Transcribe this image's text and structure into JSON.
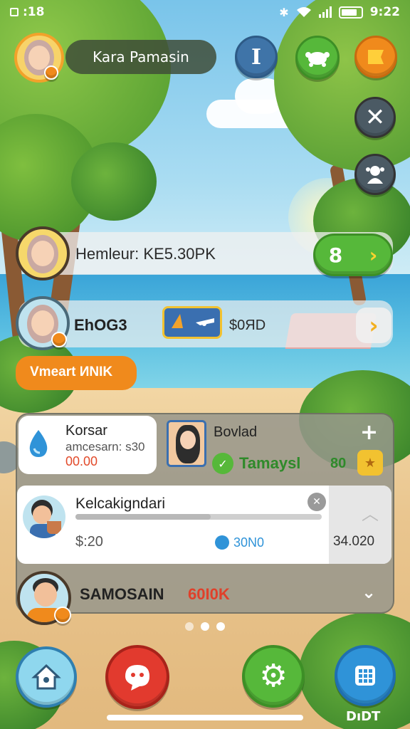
{
  "status_bar": {
    "time": ":18",
    "clock_right": "9:22"
  },
  "header": {
    "player_name": "Kara Pamasin"
  },
  "rows": [
    {
      "label": "Hemleur: KE5.30PK",
      "count": "8"
    },
    {
      "label": "EhOG3",
      "value": "$0ЯD",
      "sub_label": "Vmeart ИNIK"
    }
  ],
  "panel": {
    "card1": {
      "title": "Korsar",
      "subtitle": "amcesarn: s30",
      "value": "00.00"
    },
    "card2": {
      "title": "Bovlad",
      "status": "Tamaysl",
      "count": "80"
    },
    "card3": {
      "title": "Kelcakigndari",
      "left_value": "$:20",
      "mid_value": "30N0",
      "right_value": "34.020"
    },
    "row4": {
      "name": "SAMOSAIN",
      "value": "60I0K"
    }
  },
  "bottom_nav": {
    "last_label": "DıDT"
  },
  "colors": {
    "green": "#56b83a",
    "orange": "#f08a1c",
    "red": "#e23a2e",
    "blue": "#2f93d8",
    "light_blue": "#7fd0ec"
  }
}
